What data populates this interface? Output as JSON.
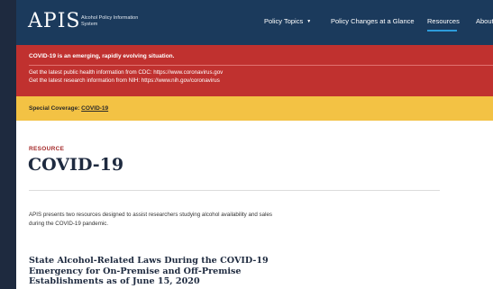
{
  "header": {
    "logo": "APIS",
    "logo_subtitle": "Alcohol Policy Information System",
    "nav": [
      {
        "label": "Policy Topics",
        "has_dropdown": true
      },
      {
        "label": "Policy Changes at a Glance"
      },
      {
        "label": "Resources",
        "active": true
      },
      {
        "label": "About"
      }
    ]
  },
  "alert": {
    "title": "COVID-19 is an emerging, rapidly evolving situation.",
    "lines": [
      "Get the latest public health information from CDC: https://www.coronavirus.gov",
      "Get the latest research information from NIH: https://www.nih.gov/coronavirus"
    ]
  },
  "special_coverage": {
    "label": "Special Coverage:",
    "link": "COVID-19"
  },
  "main": {
    "kicker": "RESOURCE",
    "title": "COVID-19",
    "intro": "APIS presents two resources designed to assist researchers studying alcohol availability and sales during the COVID-19 pandemic.",
    "section_title": "State Alcohol-Related Laws During the COVID-19 Emergency for On-Premise and Off-Premise Establishments as of June 15, 2020"
  },
  "colors": {
    "header_bg": "#1b3a5c",
    "alert_bg": "#c0312f",
    "special_bg": "#f3c244",
    "kicker": "#a52a2a",
    "nav_active_underline": "#2d9cdb"
  }
}
